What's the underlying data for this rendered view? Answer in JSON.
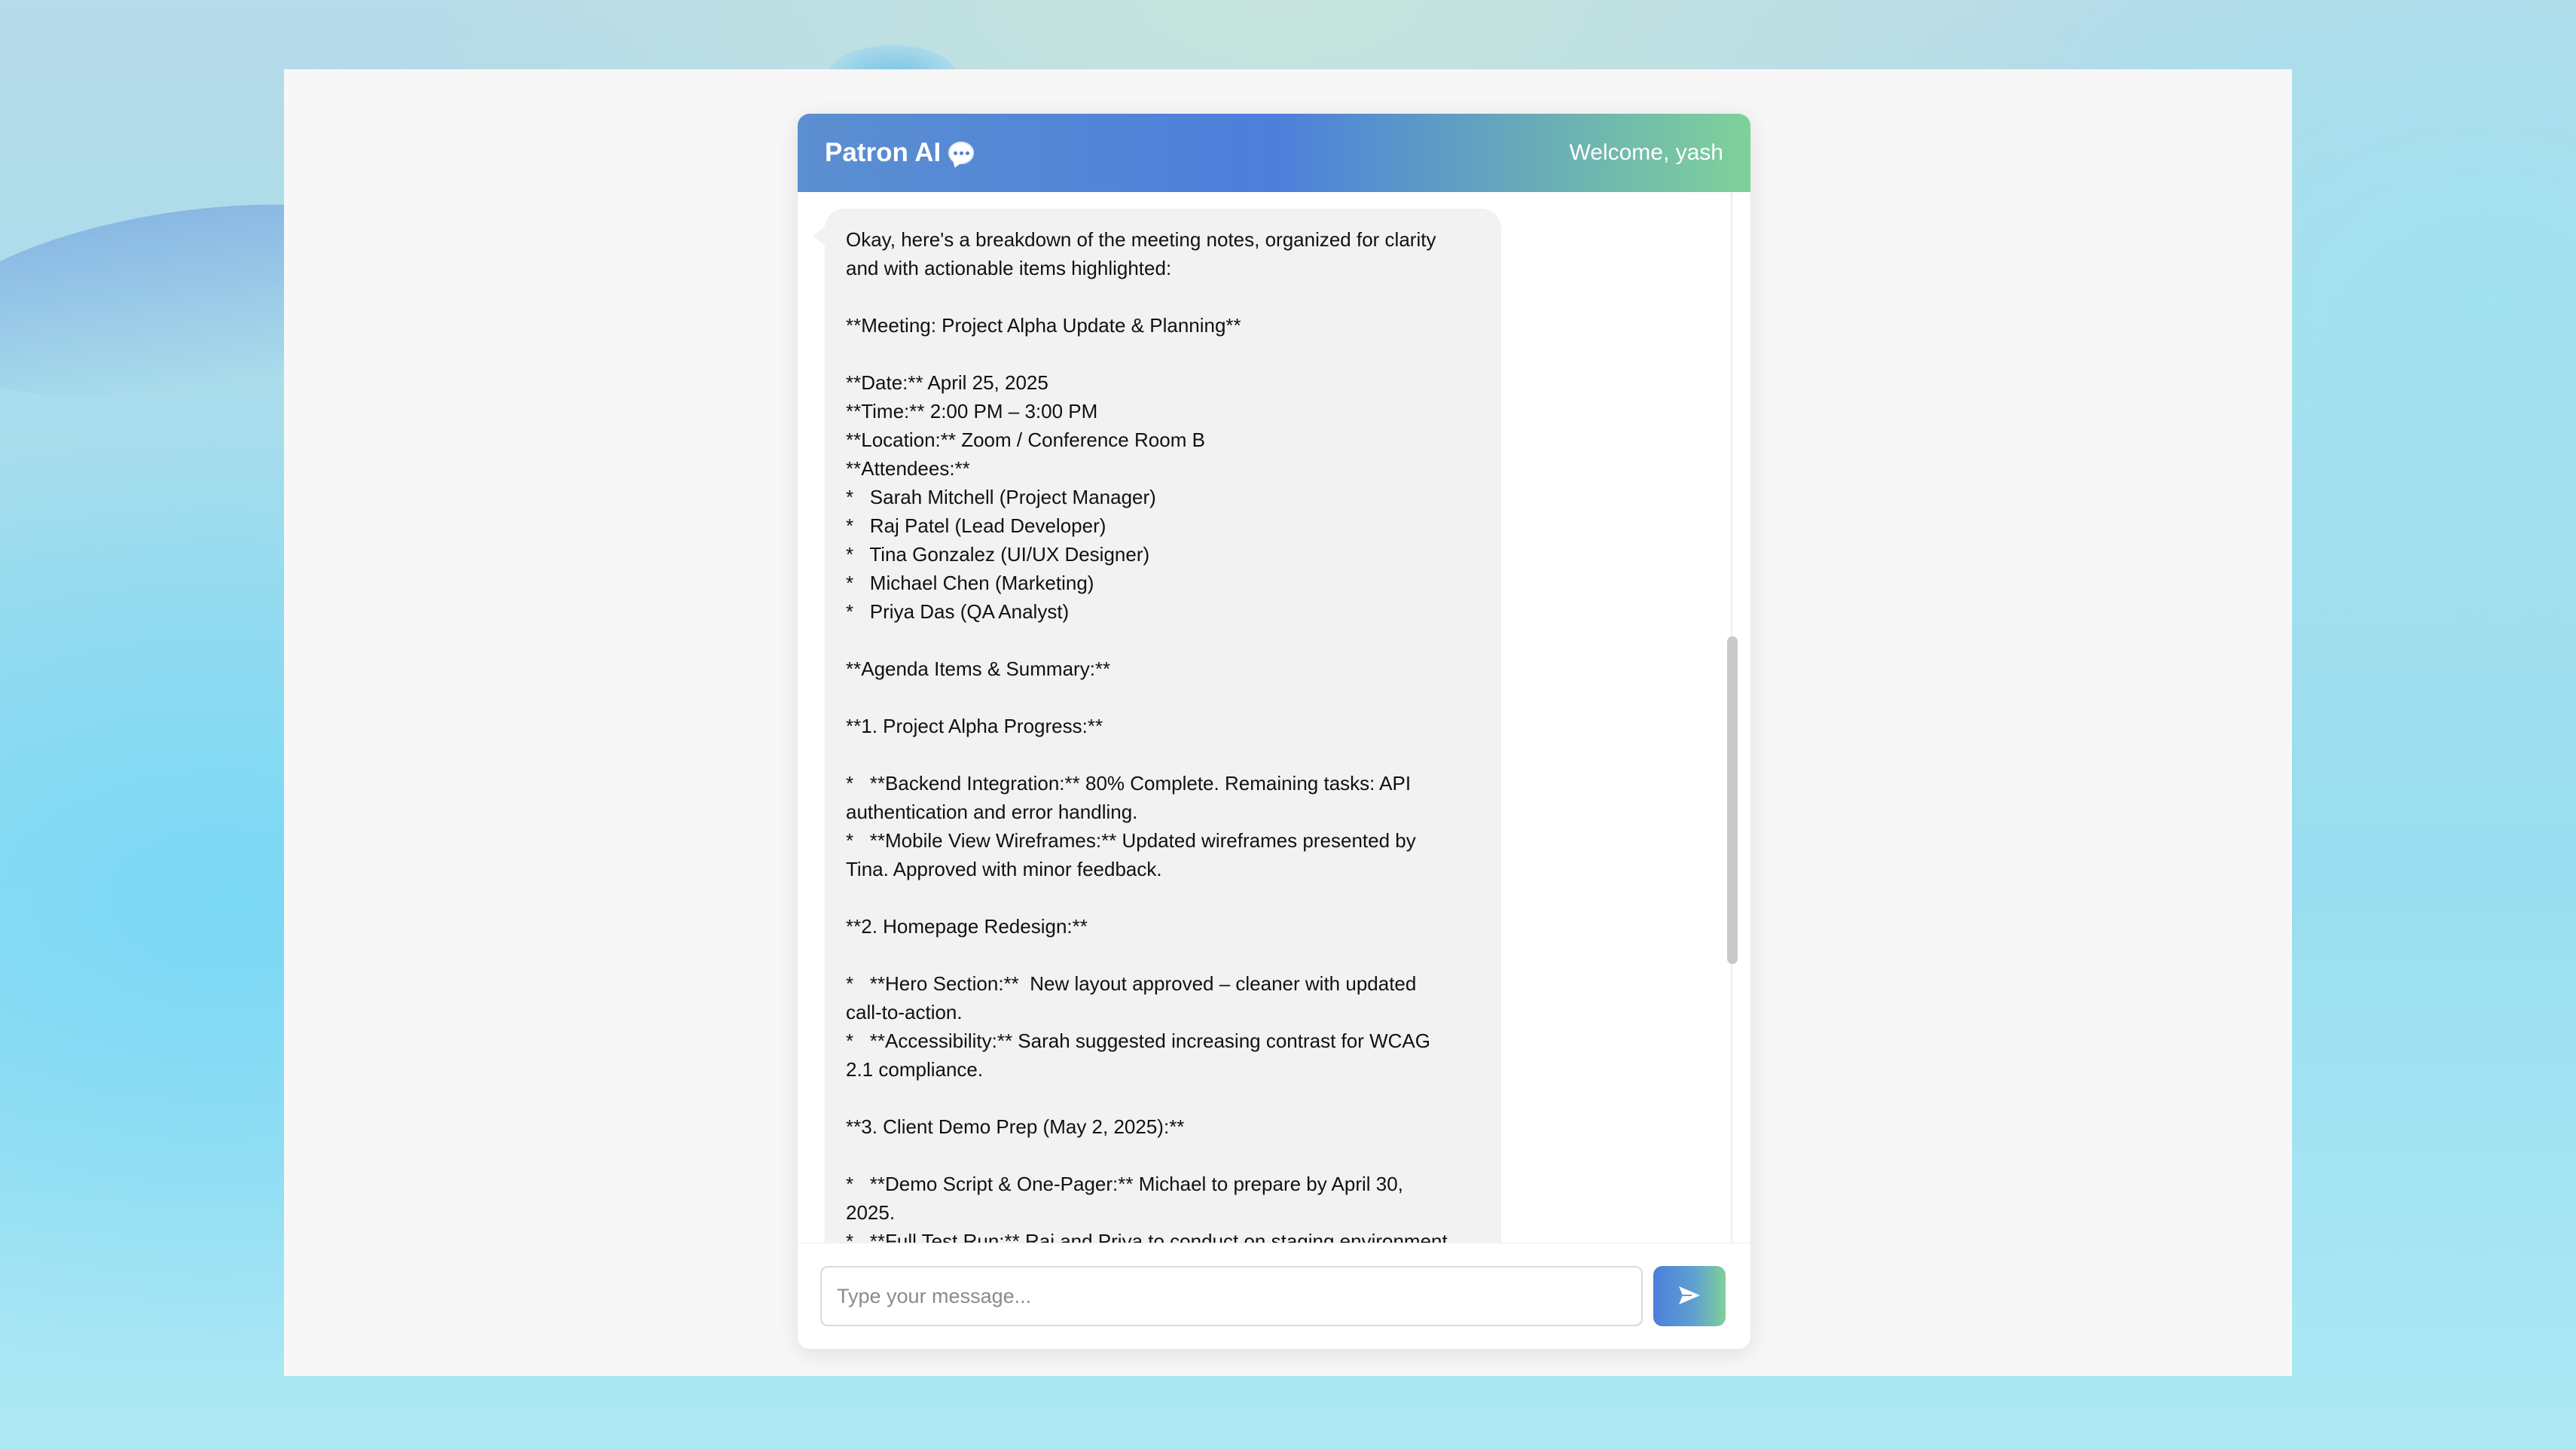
{
  "header": {
    "app_title": "Patron AI",
    "welcome_text": "Welcome, yash"
  },
  "icons": {
    "brand_icon": "speech-bubble-icon",
    "send_icon": "paper-plane-icon"
  },
  "message": {
    "lines": [
      "Okay, here's a breakdown of the meeting notes, organized for clarity",
      "and with actionable items highlighted:",
      "",
      "**Meeting: Project Alpha Update & Planning**",
      "",
      "**Date:** April 25, 2025",
      "**Time:** 2:00 PM – 3:00 PM",
      "**Location:** Zoom / Conference Room B",
      "**Attendees:**",
      "*   Sarah Mitchell (Project Manager)",
      "*   Raj Patel (Lead Developer)",
      "*   Tina Gonzalez (UI/UX Designer)",
      "*   Michael Chen (Marketing)",
      "*   Priya Das (QA Analyst)",
      "",
      "**Agenda Items & Summary:**",
      "",
      "**1. Project Alpha Progress:**",
      "",
      "*   **Backend Integration:** 80% Complete. Remaining tasks: API",
      "authentication and error handling.",
      "*   **Mobile View Wireframes:** Updated wireframes presented by",
      "Tina. Approved with minor feedback.",
      "",
      "**2. Homepage Redesign:**",
      "",
      "*   **Hero Section:**  New layout approved – cleaner with updated",
      "call-to-action.",
      "*   **Accessibility:** Sarah suggested increasing contrast for WCAG",
      "2.1 compliance.",
      "",
      "**3. Client Demo Prep (May 2, 2025):**",
      "",
      "*   **Demo Script & One-Pager:** Michael to prepare by April 30,",
      "2025.",
      "*   **Full Test Run:** Raj and Priya to conduct on staging environment"
    ]
  },
  "composer": {
    "placeholder": "Type your message...",
    "value": ""
  },
  "colors": {
    "header_gradient_start": "#5b8fd0",
    "header_gradient_mid": "#4d7fdc",
    "header_gradient_end": "#7fd19a",
    "bubble_bg": "#f2f2f2"
  }
}
